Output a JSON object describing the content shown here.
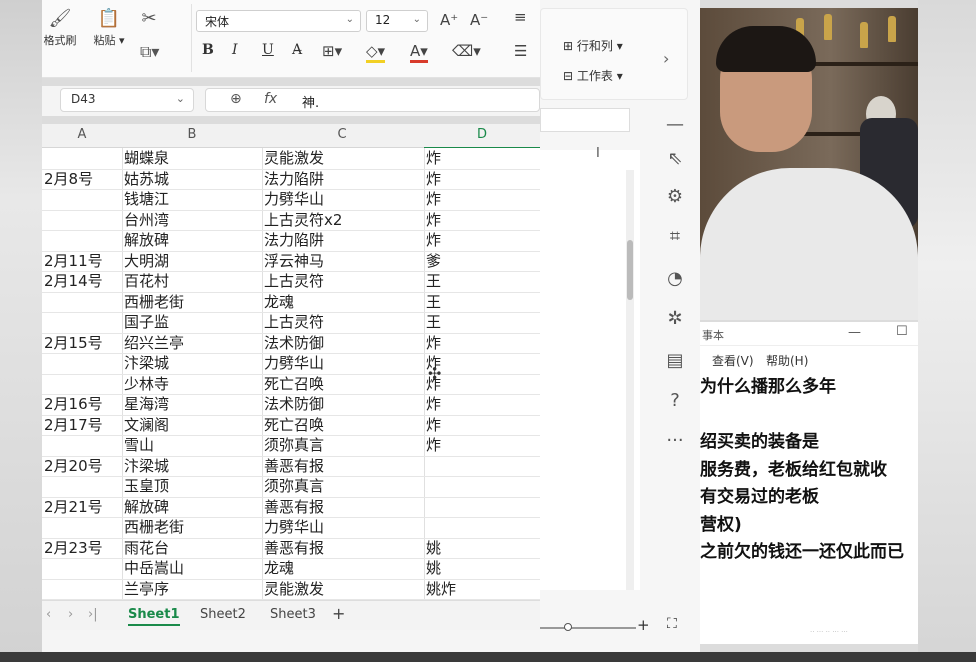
{
  "ribbon": {
    "format_painter": "格式刷",
    "paste": "粘贴",
    "font_name": "宋体",
    "font_size": "12",
    "grow_font": "A⁺",
    "shrink_font": "A⁻",
    "bold": "B",
    "italic": "I",
    "underline": "U"
  },
  "formula": {
    "cell_ref": "D43",
    "fx": "fx",
    "content": "神."
  },
  "columns": [
    "A",
    "B",
    "C",
    "D"
  ],
  "rows": [
    {
      "date": "",
      "place": "蝴蝶泉",
      "item": "灵能激发",
      "note": "炸"
    },
    {
      "date": "2月8号",
      "place": "姑苏城",
      "item": "法力陷阱",
      "note": "炸"
    },
    {
      "date": "",
      "place": "钱塘江",
      "item": "力劈华山",
      "note": "炸"
    },
    {
      "date": "",
      "place": "台州湾",
      "item": "上古灵符x2",
      "note": "炸"
    },
    {
      "date": "",
      "place": "解放碑",
      "item": "法力陷阱",
      "note": "炸"
    },
    {
      "date": "2月11号",
      "place": "大明湖",
      "item": "浮云神马",
      "note": "爹"
    },
    {
      "date": "2月14号",
      "place": "百花村",
      "item": "上古灵符",
      "note": "王"
    },
    {
      "date": "",
      "place": "西栅老街",
      "item": "龙魂",
      "note": "王"
    },
    {
      "date": "",
      "place": "国子监",
      "item": "上古灵符",
      "note": "王"
    },
    {
      "date": "2月15号",
      "place": "绍兴兰亭",
      "item": "法术防御",
      "note": "炸"
    },
    {
      "date": "",
      "place": "汴梁城",
      "item": "力劈华山",
      "note": "炸"
    },
    {
      "date": "",
      "place": "少林寺",
      "item": "死亡召唤",
      "note": "炸"
    },
    {
      "date": "2月16号",
      "place": "星海湾",
      "item": "法术防御",
      "note": "炸"
    },
    {
      "date": "2月17号",
      "place": "文澜阁",
      "item": "死亡召唤",
      "note": "炸"
    },
    {
      "date": "",
      "place": "雪山",
      "item": "须弥真言",
      "note": "炸"
    },
    {
      "date": "2月20号",
      "place": "汴梁城",
      "item": "善恶有报",
      "note": ""
    },
    {
      "date": "",
      "place": "玉皇顶",
      "item": "须弥真言",
      "note": ""
    },
    {
      "date": "2月21号",
      "place": "解放碑",
      "item": "善恶有报",
      "note": ""
    },
    {
      "date": "",
      "place": "西栅老街",
      "item": "力劈华山",
      "note": ""
    },
    {
      "date": "2月23号",
      "place": "雨花台",
      "item": "善恶有报",
      "note": "姚"
    },
    {
      "date": "",
      "place": "中岳嵩山",
      "item": "龙魂",
      "note": "姚"
    },
    {
      "date": "",
      "place": "兰亭序",
      "item": "灵能激发",
      "note": "姚炸"
    }
  ],
  "sheets": [
    "Sheet1",
    "Sheet2",
    "Sheet3"
  ],
  "active_sheet": "Sheet1",
  "add_sheet": "+",
  "mid_ribbon": {
    "rows_cols": "行和列",
    "worksheet": "工作表",
    "col_i": "I"
  },
  "notepad": {
    "title": "事本",
    "menu_view": "查看(V)",
    "menu_help": "帮助(H)",
    "lines": [
      "为什么播那么多年",
      "",
      "绍买卖的装备是",
      "服务费，老板给红包就收",
      "有交易过的老板",
      "营权)",
      "之前欠的钱还一还仅此而已"
    ]
  },
  "colors": {
    "accent_green": "#1a8a4a",
    "grid_line": "#e6e6e6"
  },
  "icons": [
    "format-painter-icon",
    "paste-icon",
    "scissors-icon",
    "search-icon",
    "cursor-icon",
    "settings-icon",
    "help-icon",
    "more-icon",
    "expand-icon"
  ]
}
